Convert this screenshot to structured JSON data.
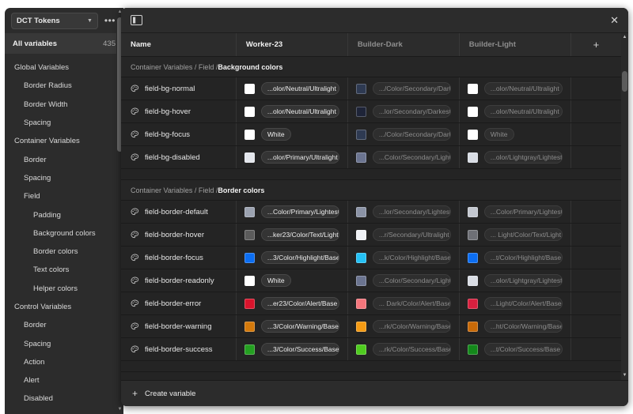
{
  "sidebar": {
    "file_name": "DCT Tokens",
    "more_label": "•••",
    "all_variables_label": "All variables",
    "all_variables_count": "435",
    "items": [
      {
        "label": "Global Variables",
        "level": 0
      },
      {
        "label": "Border Radius",
        "level": 1
      },
      {
        "label": "Border Width",
        "level": 1
      },
      {
        "label": "Spacing",
        "level": 1
      },
      {
        "label": "Container Variables",
        "level": 0
      },
      {
        "label": "Border",
        "level": 1
      },
      {
        "label": "Spacing",
        "level": 1
      },
      {
        "label": "Field",
        "level": 1
      },
      {
        "label": "Padding",
        "level": 2
      },
      {
        "label": "Background colors",
        "level": 2
      },
      {
        "label": "Border colors",
        "level": 2
      },
      {
        "label": "Text colors",
        "level": 2
      },
      {
        "label": "Helper colors",
        "level": 2
      },
      {
        "label": "Control Variables",
        "level": 0
      },
      {
        "label": "Border",
        "level": 1
      },
      {
        "label": "Spacing",
        "level": 1
      },
      {
        "label": "Action",
        "level": 1
      },
      {
        "label": "Alert",
        "level": 1
      },
      {
        "label": "Disabled",
        "level": 1
      }
    ]
  },
  "panel": {
    "close_label": "✕",
    "add_column_label": "+",
    "create_variable_label": "Create variable",
    "create_variable_plus": "+",
    "columns": [
      {
        "label": "Name",
        "active": true
      },
      {
        "label": "Worker-23",
        "active": true
      },
      {
        "label": "Builder-Dark",
        "active": false
      },
      {
        "label": "Builder-Light",
        "active": false
      }
    ],
    "groups": [
      {
        "breadcrumb_prefix": "Container Variables / Field / ",
        "breadcrumb_current": "Background colors",
        "rows": [
          {
            "name": "field-bg-normal",
            "values": [
              {
                "color": "#ffffff",
                "text": "...olor/Neutral/Ultralight",
                "dim": false
              },
              {
                "color": "#2e3a52",
                "text": ".../Color/Secondary/Dark",
                "dim": true
              },
              {
                "color": "#ffffff",
                "text": "...olor/Neutral/Ultralight",
                "dim": true
              }
            ]
          },
          {
            "name": "field-bg-hover",
            "values": [
              {
                "color": "#ffffff",
                "text": "...olor/Neutral/Ultralight",
                "dim": false
              },
              {
                "color": "#1e2438",
                "text": "...lor/Secondary/Darkest",
                "dim": true
              },
              {
                "color": "#ffffff",
                "text": "...olor/Neutral/Ultralight",
                "dim": true
              }
            ]
          },
          {
            "name": "field-bg-focus",
            "values": [
              {
                "color": "#ffffff",
                "text": "White",
                "dim": false
              },
              {
                "color": "#2e3a52",
                "text": ".../Color/Secondary/Dark",
                "dim": true
              },
              {
                "color": "#ffffff",
                "text": "White",
                "dim": true
              }
            ]
          },
          {
            "name": "field-bg-disabled",
            "values": [
              {
                "color": "#e3e6ec",
                "text": "...olor/Primary/Ultralight",
                "dim": false
              },
              {
                "color": "#6b7490",
                "text": "...Color/Secondary/Light",
                "dim": true
              },
              {
                "color": "#d9dde4",
                "text": "...olor/Lightgray/Lightest",
                "dim": true
              }
            ]
          }
        ]
      },
      {
        "breadcrumb_prefix": "Container Variables / Field / ",
        "breadcrumb_current": "Border colors",
        "rows": [
          {
            "name": "field-border-default",
            "values": [
              {
                "color": "#9ba2b0",
                "text": "...Color/Primary/Lightest",
                "dim": false
              },
              {
                "color": "#8b93a6",
                "text": "...lor/Secondary/Lightest",
                "dim": true
              },
              {
                "color": "#c3c7cf",
                "text": "...Color/Primary/Lightest",
                "dim": true
              }
            ]
          },
          {
            "name": "field-border-hover",
            "values": [
              {
                "color": "#5b5b5b",
                "text": "...ker23/Color/Text/Light",
                "dim": false
              },
              {
                "color": "#f0f2f6",
                "text": "...r/Secondary/Ultralight",
                "dim": true
              },
              {
                "color": "#6e7076",
                "text": "... Light/Color/Text/Light",
                "dim": true
              }
            ]
          },
          {
            "name": "field-border-focus",
            "values": [
              {
                "color": "#0c6ef2",
                "text": "...3/Color/Highlight/Base",
                "dim": false
              },
              {
                "color": "#25c1f5",
                "text": "...k/Color/Highlight/Base",
                "dim": true
              },
              {
                "color": "#0c6ef2",
                "text": "...t/Color/Highlight/Base",
                "dim": true
              }
            ]
          },
          {
            "name": "field-border-readonly",
            "values": [
              {
                "color": "#ffffff",
                "text": "White",
                "dim": false
              },
              {
                "color": "#6b7490",
                "text": "...Color/Secondary/Light",
                "dim": true
              },
              {
                "color": "#d9dde4",
                "text": "...olor/Lightgray/Lightest",
                "dim": true
              }
            ]
          },
          {
            "name": "field-border-error",
            "values": [
              {
                "color": "#d8142c",
                "text": "...er23/Color/Alert/Base",
                "dim": false
              },
              {
                "color": "#f4767c",
                "text": "... Dark/Color/Alert/Base",
                "dim": true
              },
              {
                "color": "#d8203f",
                "text": "...Light/Color/Alert/Base",
                "dim": true
              }
            ]
          },
          {
            "name": "field-border-warning",
            "values": [
              {
                "color": "#d4790b",
                "text": "...3/Color/Warning/Base",
                "dim": false
              },
              {
                "color": "#f59b14",
                "text": "...rk/Color/Warning/Base",
                "dim": true
              },
              {
                "color": "#c96a08",
                "text": "...ht/Color/Warning/Base",
                "dim": true
              }
            ]
          },
          {
            "name": "field-border-success",
            "values": [
              {
                "color": "#24a021",
                "text": "...3/Color/Success/Base",
                "dim": false
              },
              {
                "color": "#4fcc1f",
                "text": "...rk/Color/Success/Base",
                "dim": true
              },
              {
                "color": "#14881b",
                "text": "...t/Color/Success/Base",
                "dim": true
              }
            ]
          }
        ]
      }
    ]
  }
}
